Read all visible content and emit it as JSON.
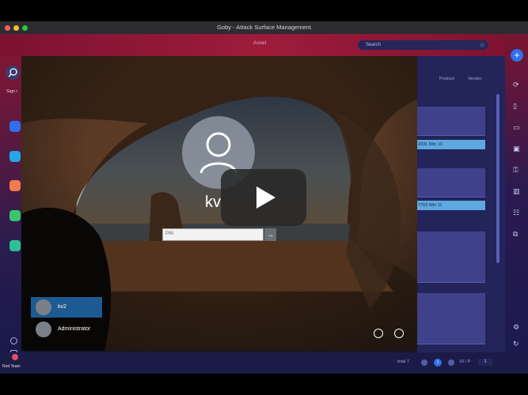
{
  "window": {
    "title": "Goby - Attack Surface Management"
  },
  "header": {
    "title": "Asset"
  },
  "search": {
    "placeholder": "Search"
  },
  "sidebar": {
    "sign_label": "Sign i",
    "team_label": "Red Team"
  },
  "tabs": {
    "product": "Product",
    "vendor": "Vendor"
  },
  "asset_rows": {
    "row1": "2031 Win 10",
    "row2": "7763 Win 11"
  },
  "login": {
    "username_partial": "kv",
    "password_field": "PIN",
    "users": [
      {
        "name": "kv2"
      },
      {
        "name": "Administrator"
      }
    ]
  },
  "pagination": {
    "total": "total 7",
    "page_current": "1",
    "per_page": "10 / P",
    "goto": "1"
  },
  "colors": {
    "brand_red": "#9e1c3b",
    "accent_blue": "#2f6ff0",
    "highlight": "#5fa8e0"
  },
  "icons": {
    "play": "play-button-icon",
    "user": "user-icon",
    "ease_of_access": "ease-of-access-icon",
    "power": "power-icon"
  }
}
